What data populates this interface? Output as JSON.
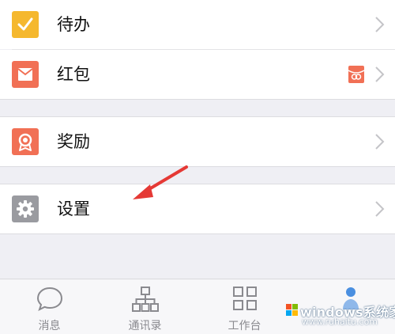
{
  "menu": {
    "items": [
      {
        "label": "待办",
        "icon": "checkmark-icon",
        "color": "#f5b82e"
      },
      {
        "label": "红包",
        "icon": "red-envelope-icon",
        "color": "#f17055"
      },
      {
        "label": "奖励",
        "icon": "reward-medal-icon",
        "color": "#f17055"
      },
      {
        "label": "设置",
        "icon": "gear-icon",
        "color": "#9a9ba0"
      }
    ]
  },
  "tabbar": {
    "tabs": [
      {
        "label": "消息",
        "icon": "chat-bubble-icon"
      },
      {
        "label": "通讯录",
        "icon": "org-chart-icon"
      },
      {
        "label": "工作台",
        "icon": "grid-icon"
      },
      {
        "label": "",
        "icon": "profile-icon"
      }
    ]
  },
  "watermark": {
    "title": "windows系统家园",
    "subtitle": "www.ruhaitu.com"
  },
  "colors": {
    "annotation_arrow": "#e53935",
    "background": "#efeff4"
  }
}
